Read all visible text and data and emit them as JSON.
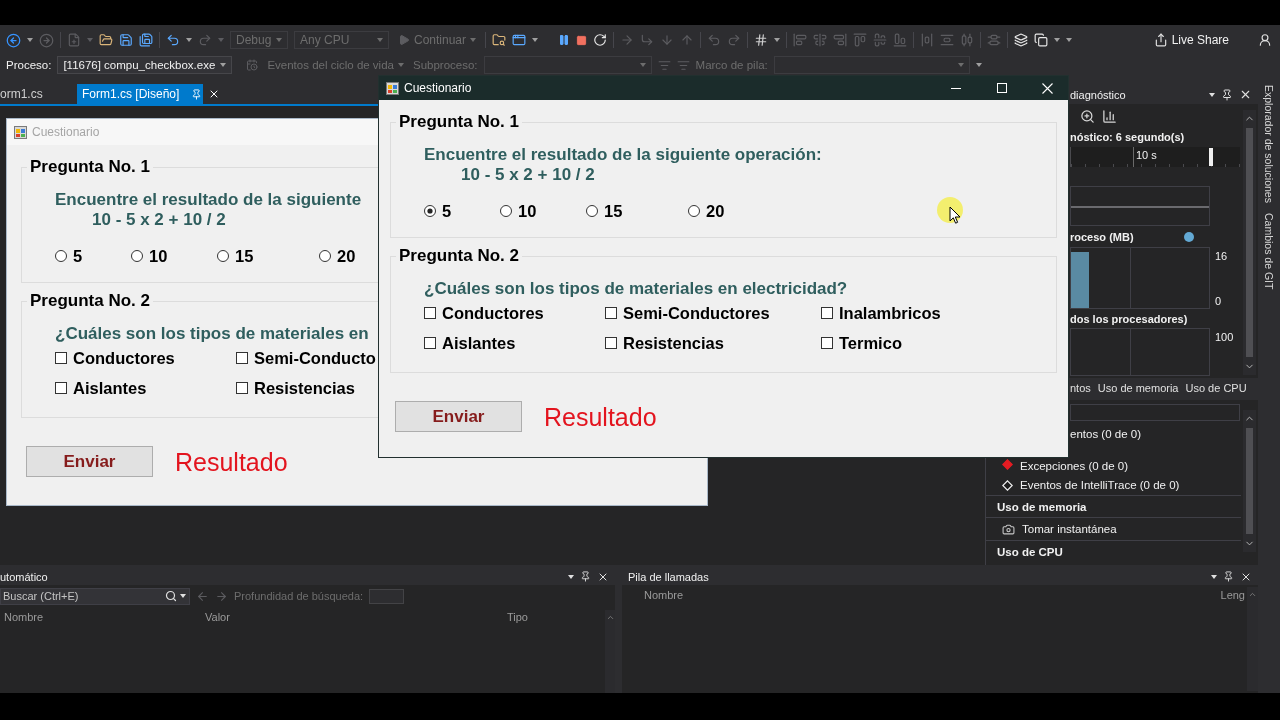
{
  "toolbar": {
    "configuration": {
      "value": "Debug",
      "disabled": true
    },
    "platform": {
      "value": "Any CPU",
      "disabled": true
    },
    "continue_button": {
      "label": "Continuar",
      "disabled": true
    },
    "live_share_button": "Live Share"
  },
  "debug_location": {
    "process_label": "Proceso:",
    "process": "[11676] compu_checkbox.exe",
    "lifecycle_events": {
      "label": "Eventos del ciclo de vida",
      "disabled": true
    },
    "thread": {
      "label": "Subproceso:",
      "disabled": true
    },
    "stack_frame": {
      "label": "Marco de pila:",
      "disabled": true
    }
  },
  "document_tabs": [
    {
      "label": "orm1.cs",
      "selected": false
    },
    {
      "label": "Form1.cs [Diseño]",
      "selected": true
    }
  ],
  "designer_form": {
    "title": "Cuestionario",
    "active": false,
    "groups": [
      {
        "kind": "single_choice",
        "title": "Pregunta No. 1",
        "question": "Encuentre el resultado de la siguiente",
        "expression": "10 - 5 x 2 + 10 / 2",
        "options": [
          {
            "label": "5",
            "selected": false
          },
          {
            "label": "10",
            "selected": false
          },
          {
            "label": "15",
            "selected": false
          },
          {
            "label": "20",
            "selected": false
          }
        ]
      },
      {
        "kind": "multiple_choice",
        "title": "Pregunta No. 2",
        "question": "¿Cuáles son los tipos de materiales en",
        "option_rows": [
          [
            {
              "label": "Conductores",
              "checked": false
            },
            {
              "label": "Semi-Conducto",
              "checked": false
            }
          ],
          [
            {
              "label": "Aislantes",
              "checked": false
            },
            {
              "label": "Resistencias",
              "checked": false
            }
          ]
        ]
      }
    ],
    "submit_button": "Enviar",
    "result": "Resultado"
  },
  "diagnostics": {
    "title": "diagnóstico",
    "session": "nóstico: 6 segundo(s)",
    "timeline_label": "10 s",
    "memory": {
      "label": "roceso (MB)",
      "max": "16",
      "min": "0"
    },
    "cpu": {
      "label": "dos los procesadores)",
      "max": "100"
    },
    "tabs": [
      {
        "label": "ntos",
        "selected": false
      },
      {
        "label": "Uso de memoria",
        "selected": false
      },
      {
        "label": "Uso de CPU",
        "selected": false
      }
    ],
    "rows": [
      {
        "kind": "group",
        "label": "entos (0 de 0)"
      },
      {
        "kind": "exception",
        "label": "Excepciones (0 de 0)"
      },
      {
        "kind": "event",
        "label": "Eventos de IntelliTrace (0 de 0)"
      },
      {
        "kind": "section",
        "label": "Uso de memoria"
      },
      {
        "kind": "action",
        "label": "Tomar instantánea"
      },
      {
        "kind": "section",
        "label": "Uso de CPU"
      }
    ]
  },
  "side_tabs": [
    "Explorador de soluciones",
    "Cambios de GIT"
  ],
  "autos": {
    "title": "utomático",
    "search": {
      "placeholder": "Buscar (Ctrl+E)"
    },
    "search_depth": {
      "label": "Profundidad de búsqueda:",
      "disabled": true
    },
    "columns": [
      "Nombre",
      "Valor",
      "Tipo"
    ]
  },
  "call_stack": {
    "title": "Pila de llamadas",
    "columns": [
      "Nombre",
      "Leng"
    ]
  },
  "dialog": {
    "title": "Cuestionario",
    "active": true,
    "window_controls": true,
    "groups": [
      {
        "kind": "single_choice",
        "title": "Pregunta No. 1",
        "question": "Encuentre el resultado de la siguiente operación:",
        "expression": "10 - 5 x 2 + 10 / 2",
        "options": [
          {
            "label": "5",
            "selected": true
          },
          {
            "label": "10",
            "selected": false
          },
          {
            "label": "15",
            "selected": false
          },
          {
            "label": "20",
            "selected": false
          }
        ]
      },
      {
        "kind": "multiple_choice",
        "title": "Pregunta No. 2",
        "question": "¿Cuáles son los tipos de materiales en electricidad?",
        "option_rows": [
          [
            {
              "label": "Conductores",
              "checked": false
            },
            {
              "label": "Semi-Conductores",
              "checked": false
            },
            {
              "label": "Inalambricos",
              "checked": false
            }
          ],
          [
            {
              "label": "Aislantes",
              "checked": false
            },
            {
              "label": "Resistencias",
              "checked": false
            },
            {
              "label": "Termico",
              "checked": false
            }
          ]
        ]
      }
    ],
    "submit_button": "Enviar",
    "result": "Resultado"
  }
}
